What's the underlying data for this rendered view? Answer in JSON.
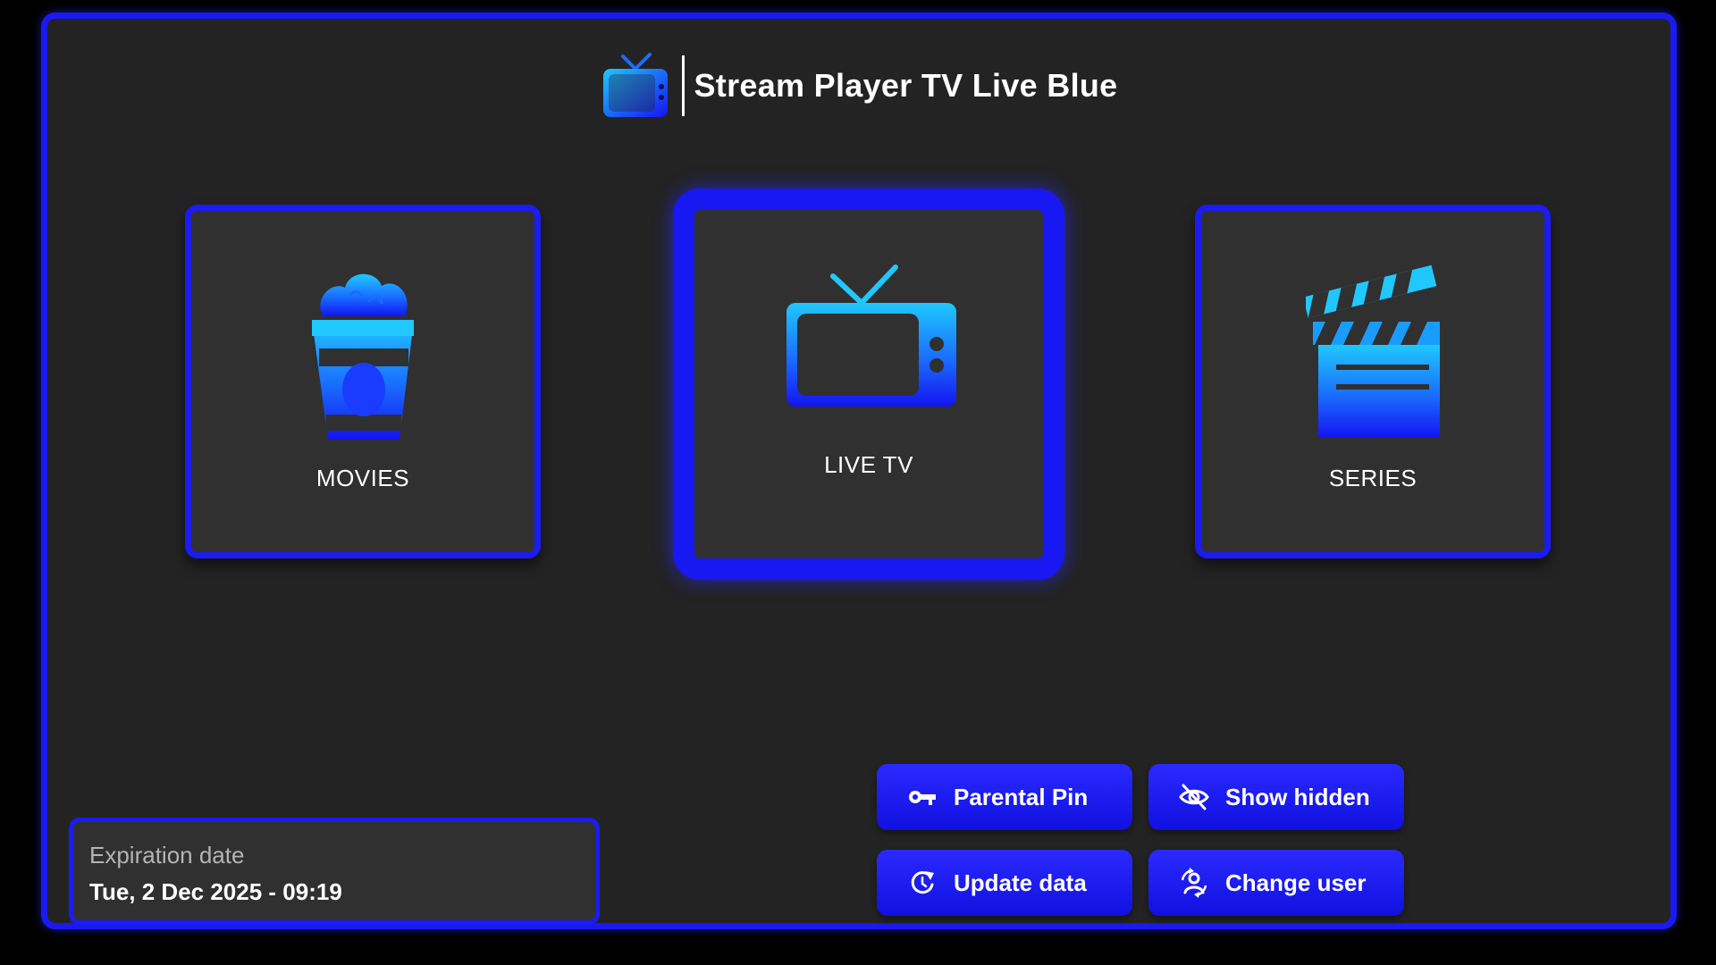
{
  "app": {
    "title": "Stream Player TV Live Blue",
    "logo_icon": "tv-icon"
  },
  "colors": {
    "accent": "#1a1af0",
    "background": "#232323",
    "tile": "#303030",
    "icon_light": "#20c8ff",
    "icon_dark": "#1414f0"
  },
  "tiles": [
    {
      "id": "movies",
      "label": "MOVIES",
      "icon": "popcorn-icon",
      "selected": false
    },
    {
      "id": "live-tv",
      "label": "LIVE TV",
      "icon": "tv-icon",
      "selected": true
    },
    {
      "id": "series",
      "label": "SERIES",
      "icon": "clapperboard-icon",
      "selected": false
    }
  ],
  "expiration": {
    "label": "Expiration date",
    "value": "Tue, 2 Dec 2025 - 09:19"
  },
  "actions": [
    {
      "id": "parental-pin",
      "label": "Parental Pin",
      "icon": "key-icon"
    },
    {
      "id": "show-hidden",
      "label": "Show hidden",
      "icon": "eye-off-icon"
    },
    {
      "id": "update-data",
      "label": "Update data",
      "icon": "refresh-icon"
    },
    {
      "id": "change-user",
      "label": "Change user",
      "icon": "user-switch-icon"
    }
  ]
}
